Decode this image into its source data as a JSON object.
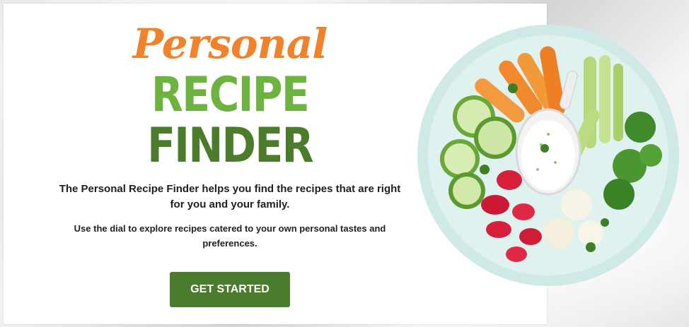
{
  "logo": {
    "line1": "Personal",
    "line2": "RECIPE",
    "line3": "FINDER"
  },
  "intro_text": "The Personal Recipe Finder helps you find the recipes that are right for you and your family.",
  "instruction_text": "Use the dial to explore recipes catered to your own personal tastes and preferences.",
  "cta": {
    "label": "GET STARTED"
  },
  "colors": {
    "personal_orange": "#f2822a",
    "recipe_green": "#6db33f",
    "finder_green": "#4a7c2b",
    "button_green": "#4a7c2b"
  }
}
